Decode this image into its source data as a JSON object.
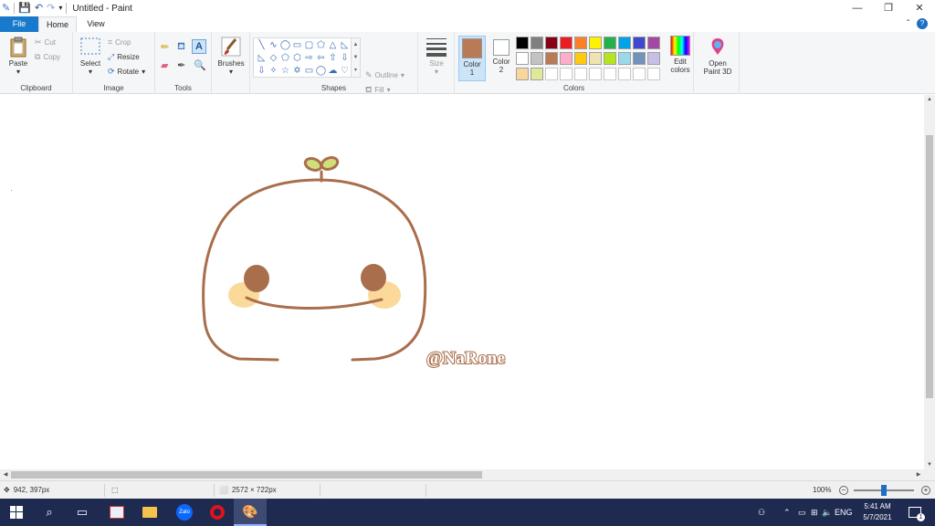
{
  "window": {
    "title": "Untitled - Paint",
    "minimize_glyph": "—",
    "restore_glyph": "❐",
    "close_glyph": "✕"
  },
  "tabs": [
    "File",
    "Home",
    "View"
  ],
  "ribbon": {
    "clipboard": {
      "label": "Clipboard",
      "paste": "Paste",
      "cut": "Cut",
      "copy": "Copy"
    },
    "image": {
      "label": "Image",
      "select": "Select",
      "crop": "Crop",
      "resize": "Resize",
      "rotate": "Rotate"
    },
    "tools": {
      "label": "Tools"
    },
    "brushes": {
      "label": "Brushes"
    },
    "shapes": {
      "label": "Shapes",
      "outline": "Outline",
      "fill": "Fill"
    },
    "size": {
      "label": "Size"
    },
    "colors": {
      "label": "Colors",
      "color1": "Color\n1",
      "color1_line1": "Color",
      "color1_line2": "1",
      "color2_line1": "Color",
      "color2_line2": "2",
      "color1_value": "#b97a57",
      "color2_value": "#ffffff",
      "edit_line1": "Edit",
      "edit_line2": "colors",
      "palette": [
        "#000000",
        "#7f7f7f",
        "#880015",
        "#ed1c24",
        "#ff7f27",
        "#fff200",
        "#22b14c",
        "#00a2e8",
        "#3f48cc",
        "#a349a4",
        "#ffffff",
        "#c3c3c3",
        "#b97a57",
        "#ffaec9",
        "#ffc90e",
        "#efe4b0",
        "#b5e61d",
        "#99d9ea",
        "#7092be",
        "#c8bfe7",
        "#f7d79b",
        "#e0e89a",
        "#ffffff",
        "#ffffff",
        "#ffffff",
        "#ffffff",
        "#ffffff",
        "#ffffff",
        "#ffffff",
        "#ffffff"
      ]
    },
    "paint3d": {
      "line1": "Open",
      "line2": "Paint 3D"
    }
  },
  "canvas": {
    "signature": "@NaRone",
    "outline_color": "#a96e4c",
    "cheek_color": "#fbd99b",
    "eye_color": "#a96e4c",
    "leaf_color": "#cfe07a"
  },
  "status": {
    "cursor_pos": "942, 397px",
    "canvas_size": "2572 × 722px",
    "zoom": "100%"
  },
  "taskbar": {
    "lang": "ENG",
    "time": "5:41 AM",
    "date": "5/7/2021",
    "notification_count": "1",
    "apps": [
      "start-icon",
      "search-icon",
      "task-view-icon",
      "photos-icon",
      "file-explorer-icon",
      "zalo-icon",
      "opera-icon",
      "paint-icon"
    ]
  }
}
